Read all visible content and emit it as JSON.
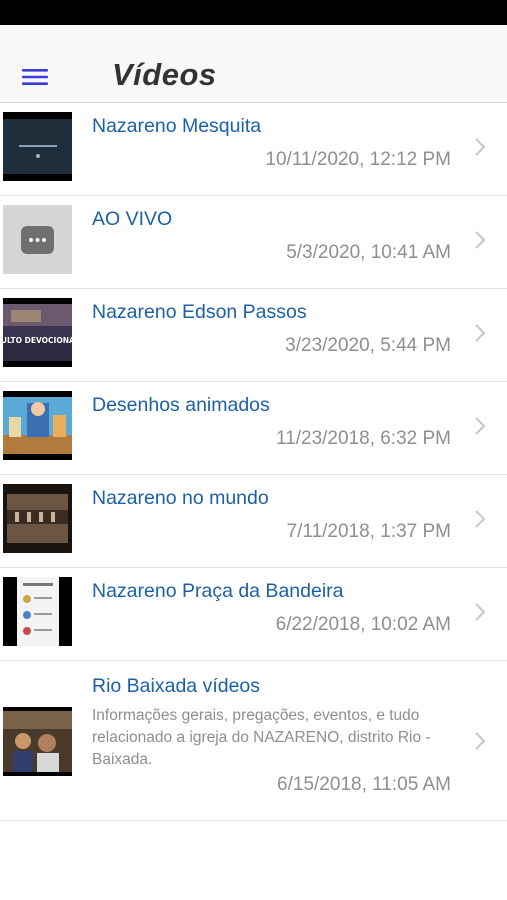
{
  "header": {
    "title": "Vídeos",
    "menu_icon": "hamburger-menu-icon",
    "accent": "#3b3bd6"
  },
  "colors": {
    "title": "#1c61a8",
    "secondary": "#8e8e93"
  },
  "videos": [
    {
      "title": "Nazareno Mesquita",
      "date": "10/11/2020, 12:12 PM"
    },
    {
      "title": "AO VIVO",
      "date": "5/3/2020, 10:41 AM"
    },
    {
      "title": "Nazareno Edson Passos",
      "date": "3/23/2020, 5:44 PM",
      "thumb_text": "CULTO DEVOCIONAL"
    },
    {
      "title": "Desenhos animados",
      "date": "11/23/2018, 6:32 PM"
    },
    {
      "title": "Nazareno no mundo",
      "date": "7/11/2018, 1:37 PM"
    },
    {
      "title": "Nazareno Praça da Bandeira",
      "date": "6/22/2018, 10:02 AM"
    },
    {
      "title": "Rio Baixada vídeos",
      "description": "Informações gerais, pregações, eventos, e tudo relacionado a igreja do NAZARENO, distrito Rio - Baixada.",
      "date": "6/15/2018, 11:05 AM"
    }
  ]
}
